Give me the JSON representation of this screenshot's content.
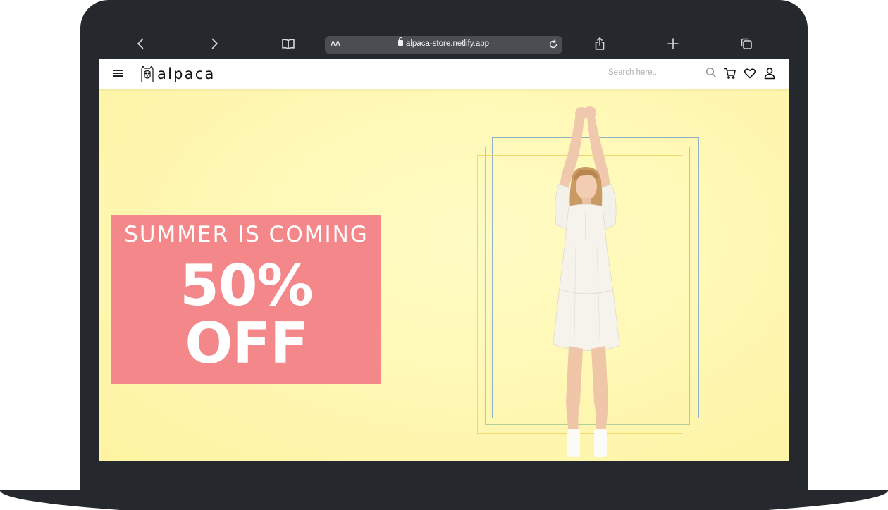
{
  "browser": {
    "reader_label": "AA",
    "url": "alpaca-store.netlify.app"
  },
  "site": {
    "logo_text": "alpaca",
    "search": {
      "placeholder": "Search here..."
    }
  },
  "hero": {
    "subtitle": "SUMMER IS COMING",
    "headline_line1": "50%",
    "headline_line2": "OFF"
  },
  "colors": {
    "device_frame": "#25292e",
    "hero_background": "#fff7b3",
    "promo_box": "#f4878a",
    "frame_blue": "#8fb1c4",
    "frame_yellow": "#f2d66b",
    "frame_green": "#b5cf9a"
  },
  "icons": {
    "browser": [
      "back-arrow-icon",
      "forward-arrow-icon",
      "book-icon",
      "lock-icon",
      "reload-icon",
      "share-icon",
      "plus-icon",
      "tabs-icon"
    ],
    "site": [
      "hamburger-menu-icon",
      "alpaca-logo-icon",
      "search-icon",
      "cart-icon",
      "heart-icon",
      "user-icon"
    ]
  }
}
